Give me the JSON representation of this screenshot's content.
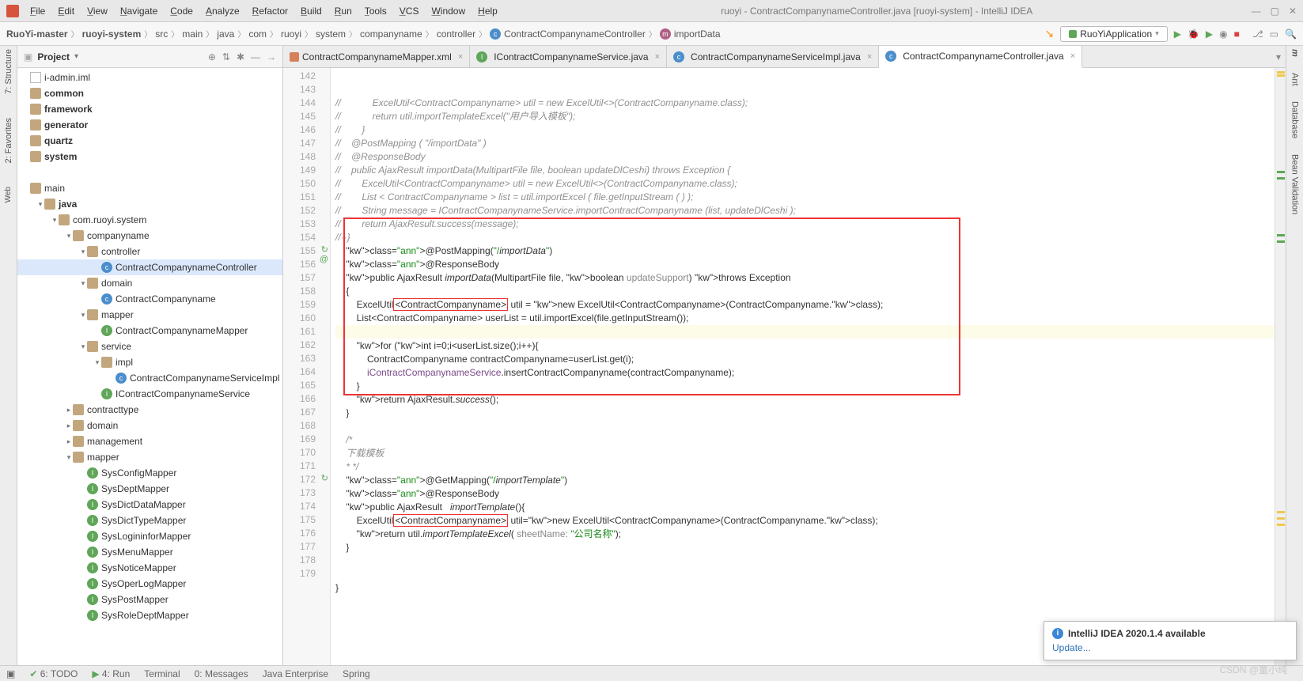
{
  "window": {
    "title": "ruoyi - ContractCompanynameController.java [ruoyi-system] - IntelliJ IDEA",
    "menu": [
      "File",
      "Edit",
      "View",
      "Navigate",
      "Code",
      "Analyze",
      "Refactor",
      "Build",
      "Run",
      "Tools",
      "VCS",
      "Window",
      "Help"
    ]
  },
  "breadcrumb": {
    "parts": [
      "RuoYi-master",
      "ruoyi-system",
      "src",
      "main",
      "java",
      "com",
      "ruoyi",
      "system",
      "companyname",
      "controller"
    ],
    "class": "ContractCompanynameController",
    "method": "importData",
    "runcfg": "RuoYiApplication"
  },
  "project": {
    "label": "Project",
    "nodes": [
      {
        "depth": 0,
        "tw": "",
        "ic": "file",
        "label": "i-admin.iml"
      },
      {
        "depth": 0,
        "tw": "",
        "ic": "fold",
        "label": "common",
        "bold": true
      },
      {
        "depth": 0,
        "tw": "",
        "ic": "fold",
        "label": "framework",
        "bold": true
      },
      {
        "depth": 0,
        "tw": "",
        "ic": "fold",
        "label": "generator",
        "bold": true
      },
      {
        "depth": 0,
        "tw": "",
        "ic": "fold",
        "label": "quartz",
        "bold": true
      },
      {
        "depth": 0,
        "tw": "",
        "ic": "fold",
        "label": "system",
        "bold": true
      },
      {
        "depth": 0,
        "tw": "",
        "ic": "",
        "label": ""
      },
      {
        "depth": 0,
        "tw": "",
        "ic": "fold",
        "label": "main"
      },
      {
        "depth": 1,
        "tw": "▾",
        "ic": "fold",
        "label": "java",
        "bold": true
      },
      {
        "depth": 2,
        "tw": "▾",
        "ic": "fold",
        "label": "com.ruoyi.system"
      },
      {
        "depth": 3,
        "tw": "▾",
        "ic": "fold",
        "label": "companyname"
      },
      {
        "depth": 4,
        "tw": "▾",
        "ic": "fold",
        "label": "controller"
      },
      {
        "depth": 5,
        "tw": "",
        "ic": "cls",
        "label": "ContractCompanynameController",
        "sel": true
      },
      {
        "depth": 4,
        "tw": "▾",
        "ic": "fold",
        "label": "domain"
      },
      {
        "depth": 5,
        "tw": "",
        "ic": "cls",
        "label": "ContractCompanyname"
      },
      {
        "depth": 4,
        "tw": "▾",
        "ic": "fold",
        "label": "mapper"
      },
      {
        "depth": 5,
        "tw": "",
        "ic": "int",
        "label": "ContractCompanynameMapper"
      },
      {
        "depth": 4,
        "tw": "▾",
        "ic": "fold",
        "label": "service"
      },
      {
        "depth": 5,
        "tw": "▾",
        "ic": "fold",
        "label": "impl"
      },
      {
        "depth": 6,
        "tw": "",
        "ic": "cls",
        "label": "ContractCompanynameServiceImpl"
      },
      {
        "depth": 5,
        "tw": "",
        "ic": "int",
        "label": "IContractCompanynameService"
      },
      {
        "depth": 3,
        "tw": "▸",
        "ic": "fold",
        "label": "contracttype"
      },
      {
        "depth": 3,
        "tw": "▸",
        "ic": "fold",
        "label": "domain"
      },
      {
        "depth": 3,
        "tw": "▸",
        "ic": "fold",
        "label": "management"
      },
      {
        "depth": 3,
        "tw": "▾",
        "ic": "fold",
        "label": "mapper"
      },
      {
        "depth": 4,
        "tw": "",
        "ic": "int",
        "label": "SysConfigMapper"
      },
      {
        "depth": 4,
        "tw": "",
        "ic": "int",
        "label": "SysDeptMapper"
      },
      {
        "depth": 4,
        "tw": "",
        "ic": "int",
        "label": "SysDictDataMapper"
      },
      {
        "depth": 4,
        "tw": "",
        "ic": "int",
        "label": "SysDictTypeMapper"
      },
      {
        "depth": 4,
        "tw": "",
        "ic": "int",
        "label": "SysLogininforMapper"
      },
      {
        "depth": 4,
        "tw": "",
        "ic": "int",
        "label": "SysMenuMapper"
      },
      {
        "depth": 4,
        "tw": "",
        "ic": "int",
        "label": "SysNoticeMapper"
      },
      {
        "depth": 4,
        "tw": "",
        "ic": "int",
        "label": "SysOperLogMapper"
      },
      {
        "depth": 4,
        "tw": "",
        "ic": "int",
        "label": "SysPostMapper"
      },
      {
        "depth": 4,
        "tw": "",
        "ic": "int",
        "label": "SysRoleDeptMapper"
      }
    ]
  },
  "tabs": [
    {
      "ic": "xml",
      "label": "ContractCompanynameMapper.xml",
      "active": false
    },
    {
      "ic": "int",
      "label": "IContractCompanynameService.java",
      "active": false
    },
    {
      "ic": "cls",
      "label": "ContractCompanynameServiceImpl.java",
      "active": false
    },
    {
      "ic": "cls",
      "label": "ContractCompanynameController.java",
      "active": true
    }
  ],
  "code": {
    "firstLine": 142,
    "lines": [
      "//            ExcelUtil<ContractCompanyname> util = new ExcelUtil<>(ContractCompanyname.class);",
      "//            return util.importTemplateExcel(\"用户导入模板\");",
      "//        }",
      "//    @PostMapping ( \"/importData\" )",
      "//    @ResponseBody",
      "//    public AjaxResult importData(MultipartFile file, boolean updateDlCeshi) throws Exception {",
      "//        ExcelUtil<ContractCompanyname> util = new ExcelUtil<>(ContractCompanyname.class);",
      "//        List < ContractCompanyname > list = util.importExcel ( file.getInputStream ( ) );",
      "//        String message = IContractCompanynameService.importContractCompanyname (list, updateDlCeshi );",
      "//        return AjaxResult.success(message);",
      "//··}",
      "    @PostMapping(\"/importData\")",
      "    @ResponseBody",
      "    public AjaxResult importData(MultipartFile file, boolean updateSupport) throws Exception",
      "    {",
      "        ExcelUtil<ContractCompanyname> util = new ExcelUtil<ContractCompanyname>(ContractCompanyname.class);",
      "        List<ContractCompanyname> userList = util.importExcel(file.getInputStream());",
      "",
      "        for (int i=0;i<userList.size();i++){",
      "            ContractCompanyname contractCompanyname=userList.get(i);",
      "            iContractCompanynameService.insertContractCompanyname(contractCompanyname);",
      "        }",
      "        return AjaxResult.success();",
      "    }",
      "",
      "    /*",
      "    下载模板",
      "    * */",
      "    @GetMapping(\"/importTemplate\")",
      "    @ResponseBody",
      "    public AjaxResult   importTemplate(){",
      "        ExcelUtil<ContractCompanyname> util=new ExcelUtil<ContractCompanyname>(ContractCompanyname.class);",
      "        return util.importTemplateExcel( sheetName: \"公司名称\");",
      "    }",
      "",
      "",
      "}",
      ""
    ]
  },
  "notification": {
    "title": "IntelliJ IDEA 2020.1.4 available",
    "link": "Update..."
  },
  "watermark": "CSDN @童小纯",
  "statusbar": {
    "todo": "6: TODO",
    "run": "4: Run",
    "terminal": "Terminal",
    "messages": "0: Messages",
    "javaent": "Java Enterprise",
    "spring": "Spring"
  },
  "leftTools": [
    "2: Favorites",
    "7: Structure"
  ],
  "rightTools": [
    "Ant",
    "Database",
    "m",
    "Bean Validation"
  ]
}
